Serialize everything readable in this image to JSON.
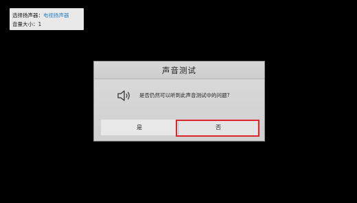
{
  "info_panel": {
    "speaker_label": "选择扬声器：",
    "speaker_value": "电视扬声器",
    "volume_label": "音量大小：1"
  },
  "dialog": {
    "title": "声音测试",
    "icon": "speaker-icon",
    "question": "是否仍然可以听到此声音测试中的问题?",
    "buttons": {
      "yes_label": "是",
      "no_label": "否"
    },
    "focused_button": "no",
    "focus_color": "#d9242b"
  }
}
